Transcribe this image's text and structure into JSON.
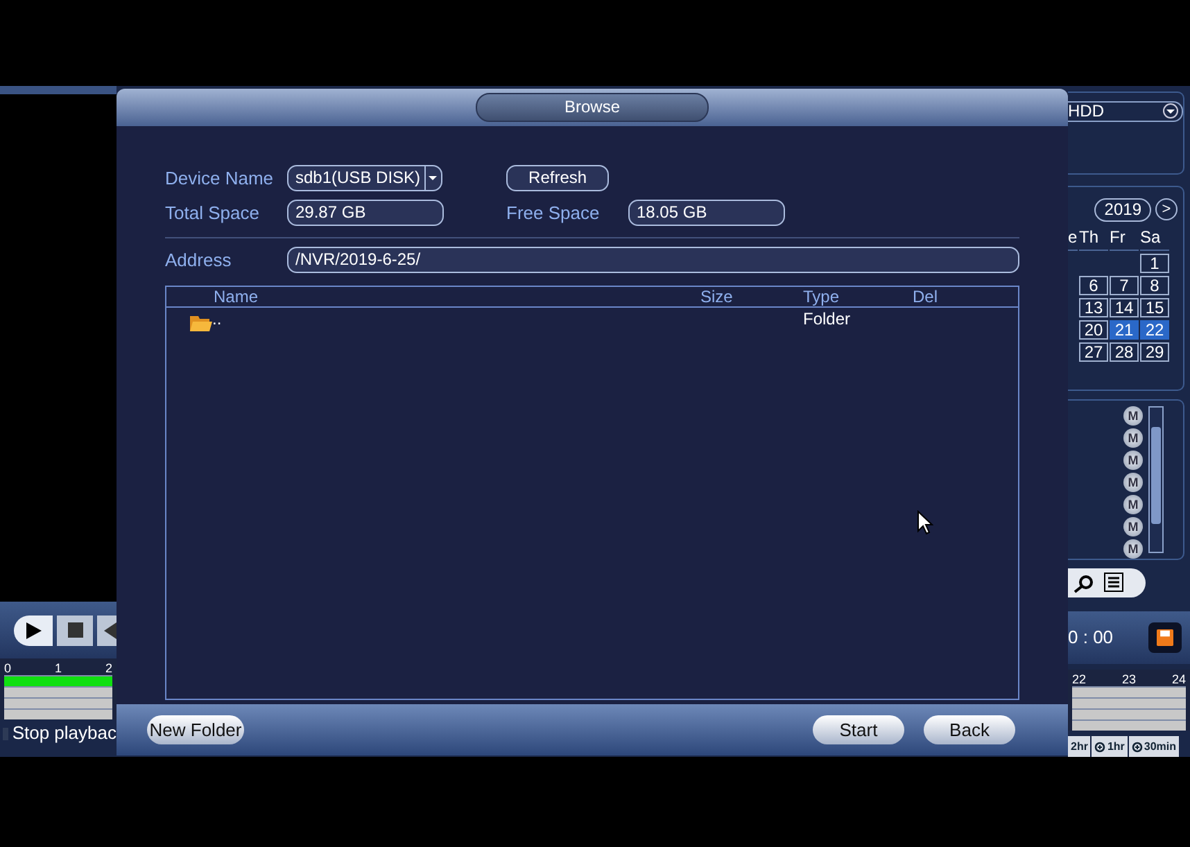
{
  "background": {
    "left_panel": {
      "timeline_ticks": [
        "0",
        "1",
        "2"
      ],
      "stop_playback": {
        "label": "Stop playbac",
        "checked": false
      }
    },
    "right_panel": {
      "storage_select": {
        "value": "HDD"
      },
      "calendar": {
        "year": "2019",
        "next": ">",
        "weekdays": [
          "e",
          "Th",
          "Fr",
          "Sa"
        ],
        "weeks": [
          [
            {
              "day": "1",
              "highlighted": false
            }
          ],
          [
            {
              "day": "6",
              "highlighted": false
            },
            {
              "day": "7",
              "highlighted": false
            },
            {
              "day": "8",
              "highlighted": false
            }
          ],
          [
            {
              "day": "13",
              "highlighted": false
            },
            {
              "day": "14",
              "highlighted": false
            },
            {
              "day": "15",
              "highlighted": false
            }
          ],
          [
            {
              "day": "20",
              "highlighted": false
            },
            {
              "day": "21",
              "highlighted": true
            },
            {
              "day": "22",
              "highlighted": true
            }
          ],
          [
            {
              "day": "27",
              "highlighted": false
            },
            {
              "day": "28",
              "highlighted": false
            },
            {
              "day": "29",
              "highlighted": false
            }
          ]
        ]
      },
      "channel_buttons": [
        "M",
        "M",
        "M",
        "M",
        "M",
        "M",
        "M"
      ],
      "time": "0 : 00",
      "timeline_ticks": [
        "22",
        "23",
        "24"
      ],
      "zoom_buttons": [
        "2hr",
        "1hr",
        "30min"
      ]
    }
  },
  "dialog": {
    "title": "Browse",
    "device_name": {
      "label": "Device Name",
      "value": "sdb1(USB DISK)"
    },
    "refresh_button": "Refresh",
    "total_space": {
      "label": "Total Space",
      "value": "29.87 GB"
    },
    "free_space": {
      "label": "Free Space",
      "value": "18.05 GB"
    },
    "address": {
      "label": "Address",
      "value": "/NVR/2019-6-25/"
    },
    "table": {
      "columns": [
        "Name",
        "Size",
        "Type",
        "Del"
      ],
      "rows": [
        {
          "name": "..",
          "type": "Folder"
        }
      ]
    },
    "buttons": {
      "new_folder": "New Folder",
      "start": "Start",
      "back": "Back"
    }
  }
}
